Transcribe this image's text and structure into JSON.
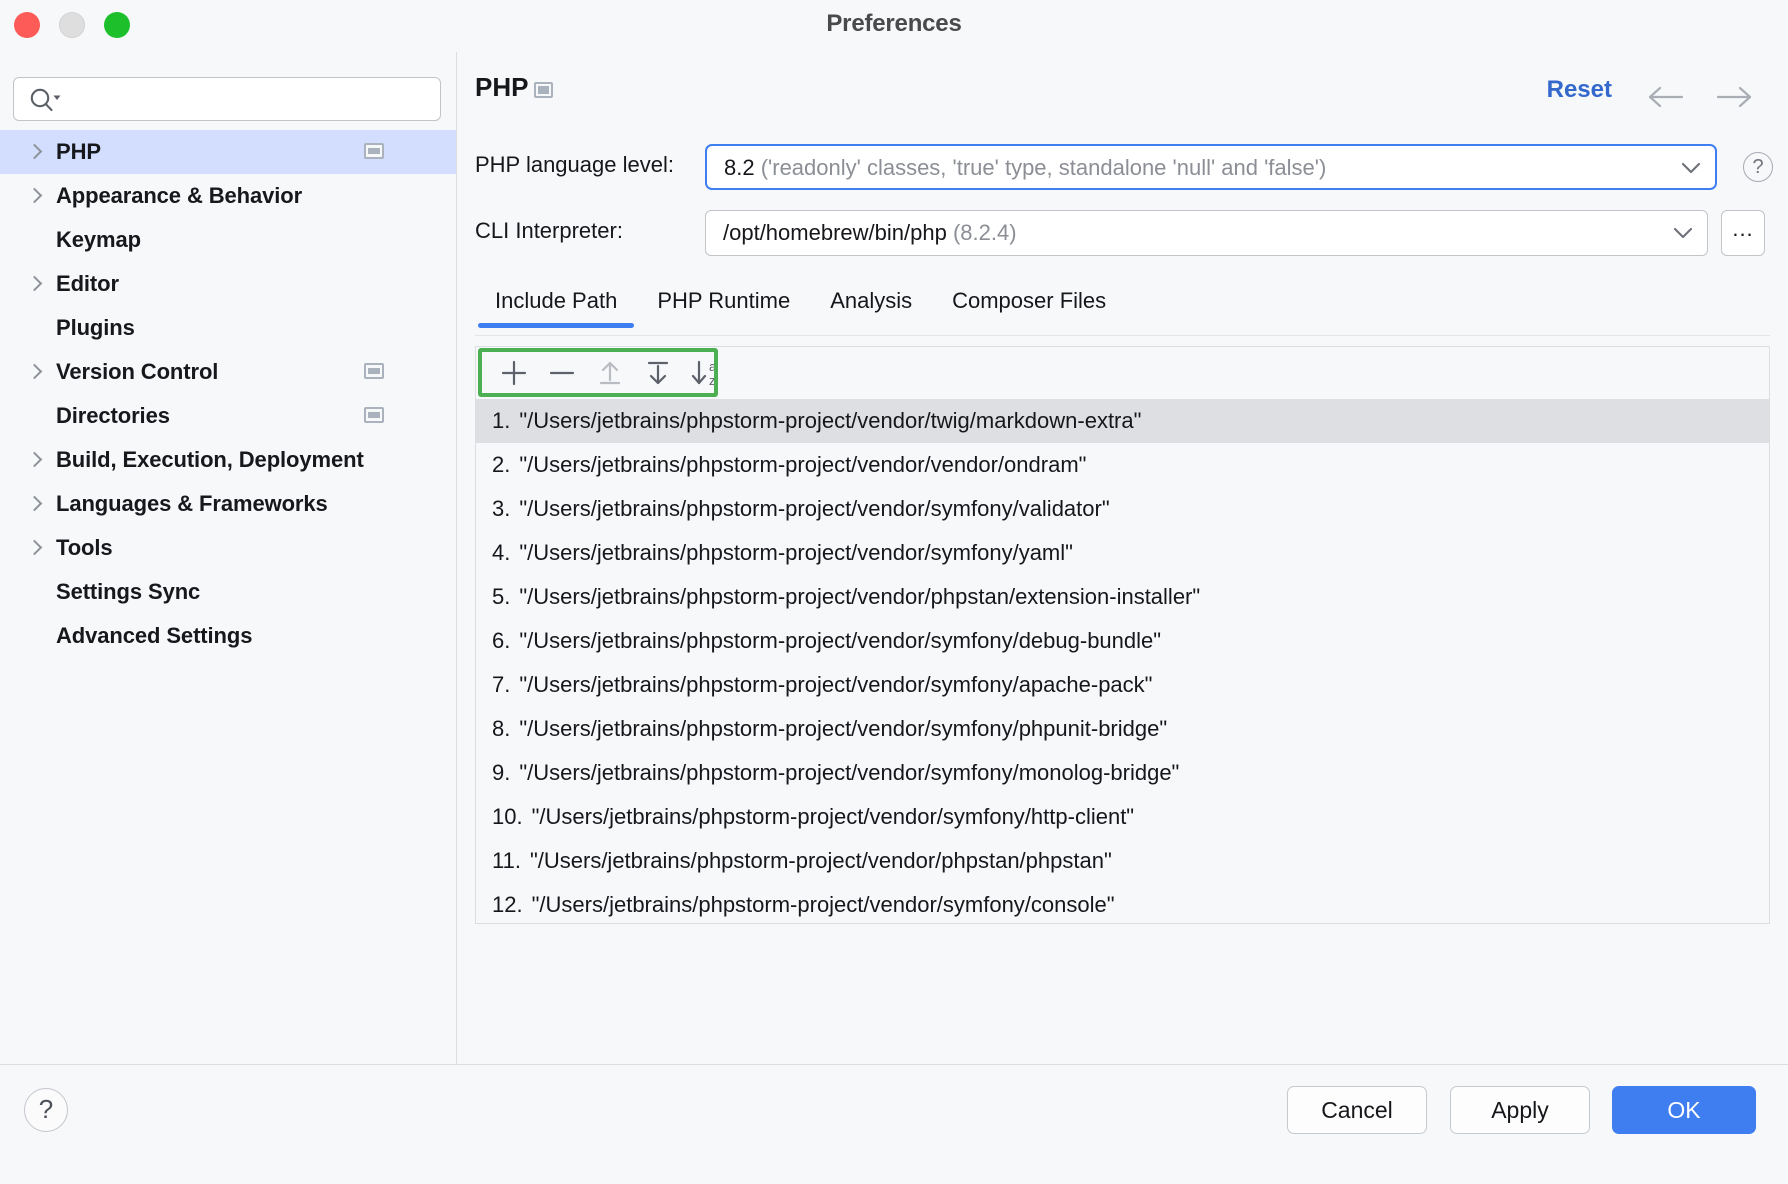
{
  "window": {
    "title": "Preferences",
    "traffic_lights": [
      "close",
      "minimize",
      "maximize"
    ]
  },
  "sidebar": {
    "search": {
      "value": "",
      "placeholder": ""
    },
    "items": [
      {
        "label": "PHP",
        "expandable": true,
        "selected": true,
        "module_badge": true
      },
      {
        "label": "Appearance & Behavior",
        "expandable": true,
        "selected": false,
        "module_badge": false
      },
      {
        "label": "Keymap",
        "expandable": false,
        "selected": false,
        "module_badge": false
      },
      {
        "label": "Editor",
        "expandable": true,
        "selected": false,
        "module_badge": false
      },
      {
        "label": "Plugins",
        "expandable": false,
        "selected": false,
        "module_badge": false
      },
      {
        "label": "Version Control",
        "expandable": true,
        "selected": false,
        "module_badge": true
      },
      {
        "label": "Directories",
        "expandable": false,
        "selected": false,
        "module_badge": true
      },
      {
        "label": "Build, Execution, Deployment",
        "expandable": true,
        "selected": false,
        "module_badge": false
      },
      {
        "label": "Languages & Frameworks",
        "expandable": true,
        "selected": false,
        "module_badge": false
      },
      {
        "label": "Tools",
        "expandable": true,
        "selected": false,
        "module_badge": false
      },
      {
        "label": "Settings Sync",
        "expandable": false,
        "selected": false,
        "module_badge": false
      },
      {
        "label": "Advanced Settings",
        "expandable": false,
        "selected": false,
        "module_badge": false
      }
    ]
  },
  "main": {
    "page_title": "PHP",
    "reset_label": "Reset",
    "back_icon": "arrow-left-icon",
    "forward_icon": "arrow-right-icon",
    "language_level": {
      "label": "PHP language level:",
      "value": "8.2",
      "value_hint": "('readonly' classes, 'true' type, standalone 'null' and 'false')",
      "focused": true,
      "help_glyph": "?"
    },
    "cli_interpreter": {
      "label": "CLI Interpreter:",
      "value": "/opt/homebrew/bin/php",
      "value_hint": "(8.2.4)",
      "browse_label": "..."
    },
    "tabs": [
      {
        "label": "Include Path",
        "active": true
      },
      {
        "label": "PHP Runtime",
        "active": false
      },
      {
        "label": "Analysis",
        "active": false
      },
      {
        "label": "Composer Files",
        "active": false
      }
    ],
    "toolbar": {
      "highlighted": true,
      "highlight_color": "#4caf52",
      "buttons": [
        {
          "name": "add-path-button",
          "icon": "plus-icon",
          "enabled": true
        },
        {
          "name": "remove-path-button",
          "icon": "minus-icon",
          "enabled": true
        },
        {
          "name": "move-up-button",
          "icon": "arrow-up-to-line-icon",
          "enabled": false
        },
        {
          "name": "move-down-button",
          "icon": "arrow-down-to-line-icon",
          "enabled": true
        },
        {
          "name": "sort-alphabetically-button",
          "icon": "sort-az-icon",
          "enabled": true
        }
      ]
    },
    "include_paths": [
      {
        "index": "1.",
        "path": "\"/Users/jetbrains/phpstorm-project/vendor/twig/markdown-extra\"",
        "selected": true
      },
      {
        "index": "2.",
        "path": "\"/Users/jetbrains/phpstorm-project/vendor/vendor/ondram\"",
        "selected": false
      },
      {
        "index": "3.",
        "path": "\"/Users/jetbrains/phpstorm-project/vendor/symfony/validator\"",
        "selected": false
      },
      {
        "index": "4.",
        "path": "\"/Users/jetbrains/phpstorm-project/vendor/symfony/yaml\"",
        "selected": false
      },
      {
        "index": "5.",
        "path": "\"/Users/jetbrains/phpstorm-project/vendor/phpstan/extension-installer\"",
        "selected": false
      },
      {
        "index": "6.",
        "path": "\"/Users/jetbrains/phpstorm-project/vendor/symfony/debug-bundle\"",
        "selected": false
      },
      {
        "index": "7.",
        "path": "\"/Users/jetbrains/phpstorm-project/vendor/symfony/apache-pack\"",
        "selected": false
      },
      {
        "index": "8.",
        "path": "\"/Users/jetbrains/phpstorm-project/vendor/symfony/phpunit-bridge\"",
        "selected": false
      },
      {
        "index": "9.",
        "path": "\"/Users/jetbrains/phpstorm-project/vendor/symfony/monolog-bridge\"",
        "selected": false
      },
      {
        "index": "10.",
        "path": "\"/Users/jetbrains/phpstorm-project/vendor/symfony/http-client\"",
        "selected": false
      },
      {
        "index": "11.",
        "path": "\"/Users/jetbrains/phpstorm-project/vendor/phpstan/phpstan\"",
        "selected": false
      },
      {
        "index": "12.",
        "path": "\"/Users/jetbrains/phpstorm-project/vendor/symfony/console\"",
        "selected": false
      }
    ]
  },
  "footer": {
    "help_glyph": "?",
    "cancel_label": "Cancel",
    "apply_label": "Apply",
    "ok_label": "OK",
    "ok_color": "#3f7ef0"
  }
}
